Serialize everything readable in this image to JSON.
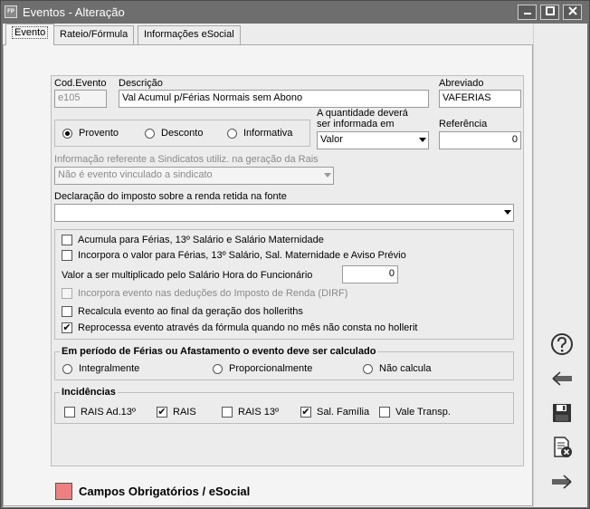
{
  "window": {
    "title": "Eventos - Alteração",
    "app_icon_text": "FP"
  },
  "tabs": [
    {
      "label": "Evento",
      "active": true
    },
    {
      "label": "Rateio/Fórmula",
      "active": false
    },
    {
      "label": "Informações eSocial",
      "active": false
    }
  ],
  "fields": {
    "cod_evento": {
      "label": "Cod.Evento",
      "value": "e105"
    },
    "descricao": {
      "label": "Descrição",
      "value": "Val Acumul p/Férias Normais sem Abono"
    },
    "abreviado": {
      "label": "Abreviado",
      "value": "VAFERIAS"
    },
    "quantidade": {
      "label_line1": "A quantidade deverá",
      "label_line2": "ser informada em",
      "value": "Valor"
    },
    "referencia": {
      "label": "Referência",
      "value": "0"
    },
    "rais_info": {
      "label": "Informação referente a Sindicatos utiliz. na geração da Rais",
      "value": "Não é evento vinculado a sindicato"
    },
    "declaracao_ir": {
      "label": "Declaração do imposto sobre a renda retida na fonte",
      "value": ""
    },
    "multiplicador": {
      "label": "Valor a ser multiplicado pelo Salário Hora do Funcionário",
      "value": "0"
    }
  },
  "tipo_radios": [
    {
      "label": "Provento",
      "selected": true
    },
    {
      "label": "Desconto",
      "selected": false
    },
    {
      "label": "Informativa",
      "selected": false
    }
  ],
  "options": [
    {
      "label": "Acumula para Férias, 13º Salário e Salário Maternidade",
      "checked": false,
      "disabled": false
    },
    {
      "label": "Incorpora o valor para Férias, 13º Salário, Sal. Maternidade e Aviso Prévio",
      "checked": false,
      "disabled": false
    },
    {
      "label": "Incorpora evento nas deduções do Imposto de Renda (DIRF)",
      "checked": false,
      "disabled": true
    },
    {
      "label": "Recalcula evento ao final da geração dos holleriths",
      "checked": false,
      "disabled": false
    },
    {
      "label": "Reprocessa evento através da fórmula quando no mês não consta no hollerit",
      "checked": true,
      "disabled": false
    }
  ],
  "ferias_group": {
    "title": "Em período de Férias ou Afastamento o evento deve ser calculado",
    "radios": [
      {
        "label": "Integralmente",
        "selected": false
      },
      {
        "label": "Proporcionalmente",
        "selected": false
      },
      {
        "label": "Não calcula",
        "selected": false
      }
    ]
  },
  "incidencias": {
    "title": "Incidências",
    "items": [
      {
        "label": "RAIS Ad.13º",
        "checked": false
      },
      {
        "label": "RAIS",
        "checked": true
      },
      {
        "label": "RAIS 13º",
        "checked": false
      },
      {
        "label": "Sal. Família",
        "checked": true
      },
      {
        "label": "Vale Transp.",
        "checked": false
      }
    ]
  },
  "legend_required": {
    "label": "Campos Obrigatórios / eSocial",
    "color": "#f08080"
  },
  "check_mark": "✔",
  "sidebar_icons": [
    "help-icon",
    "back-arrow-icon",
    "save-icon",
    "delete-document-icon",
    "forward-arrow-icon"
  ]
}
